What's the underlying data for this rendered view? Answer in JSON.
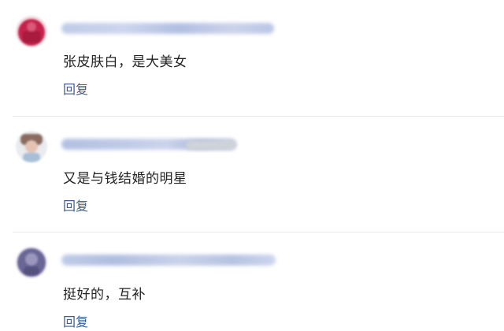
{
  "comments": [
    {
      "avatar_icon": "avatar-red-icon",
      "avatar_color": "#b01f44",
      "content": "张皮肤白，是大美女",
      "reply_label": "回复"
    },
    {
      "avatar_icon": "avatar-person-icon",
      "avatar_color": "#8a6b60",
      "content": "又是与钱结婚的明星",
      "reply_label": "回复"
    },
    {
      "avatar_icon": "avatar-purple-icon",
      "avatar_color": "#6a6696",
      "content": "挺好的，互补",
      "reply_label": "回复"
    }
  ],
  "colors": {
    "reply_link": "#3e5f8f",
    "text": "#222222",
    "divider": "#e8e8e8"
  }
}
